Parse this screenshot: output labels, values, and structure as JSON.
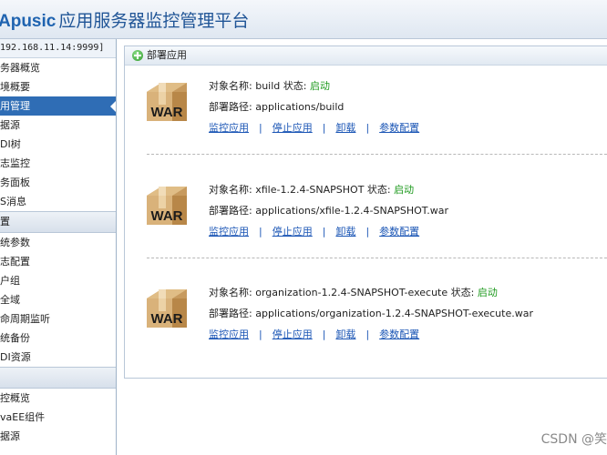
{
  "app": {
    "brand": "Apusic",
    "title": "应用服务器监控管理平台"
  },
  "sidebar": {
    "server": "192.168.11.14:9999]",
    "items": [
      "务器概览",
      "境概要",
      "用管理",
      "据源",
      "DI树",
      "志监控",
      "务面板",
      "S消息"
    ],
    "selected_index": 2,
    "section_config": "置",
    "config_items": [
      "统参数",
      "志配置",
      "户组",
      "全域",
      "命周期监听",
      "统备份",
      "DI资源"
    ],
    "monitor_items": [
      "控概览",
      "vaEE组件",
      "据源"
    ]
  },
  "panel": {
    "title": "部署应用",
    "icon": "add-circle-icon",
    "labels": {
      "object_name": "对象名称:",
      "status": "状态:",
      "deploy_path": "部署路径:",
      "monitor": "监控应用",
      "stop": "停止应用",
      "uninstall": "卸载",
      "params": "参数配置",
      "sep": "|"
    },
    "apps": [
      {
        "name": "build",
        "status": "启动",
        "path": "applications/build",
        "icon_text": "WAR"
      },
      {
        "name": "xfile-1.2.4-SNAPSHOT",
        "status": "启动",
        "path": "applications/xfile-1.2.4-SNAPSHOT.war",
        "icon_text": "WAR"
      },
      {
        "name": "organization-1.2.4-SNAPSHOT-execute",
        "status": "启动",
        "path": "applications/organization-1.2.4-SNAPSHOT-execute.war",
        "icon_text": "WAR"
      }
    ]
  },
  "watermark": "CSDN @笑",
  "colors": {
    "brand": "#1f63b0",
    "selected": "#2f6db5",
    "status_green": "#1e9a1e",
    "link": "#1a55b5",
    "war_box": "#c9a16a"
  }
}
